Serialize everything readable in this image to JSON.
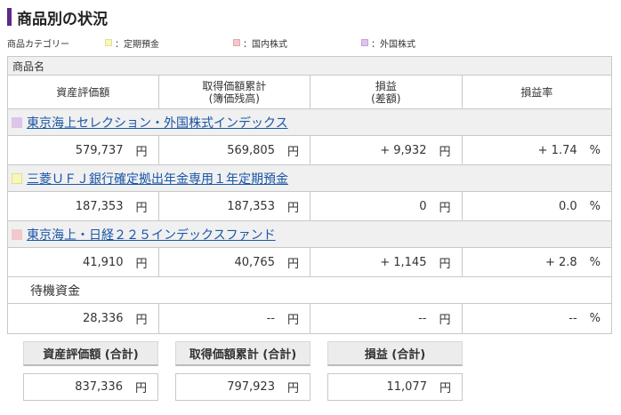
{
  "title": "商品別の状況",
  "legend": {
    "label": "商品カテゴリー",
    "items": [
      {
        "label": "：定期預金",
        "color": "#f7f7b8"
      },
      {
        "label": "：国内株式",
        "color": "#f2c8cc"
      },
      {
        "label": "：外国株式",
        "color": "#dcc4ea"
      }
    ]
  },
  "table": {
    "name_header": "商品名",
    "headers": {
      "col1": "資産評価額",
      "col2_line1": "取得価額累計",
      "col2_line2": "(簿価残高)",
      "col3_line1": "損益",
      "col3_line2": "(差額)",
      "col4": "損益率"
    },
    "unit_yen": "円",
    "unit_pct": "%",
    "products": [
      {
        "name": "東京海上セレクション・外国株式インデックス",
        "color": "#dcc4ea",
        "value": "579,737",
        "cost": "569,805",
        "pl": "+ 9,932",
        "rate": "+ 1.74"
      },
      {
        "name": "三菱ＵＦＪ銀行確定拠出年金専用１年定期預金",
        "color": "#f7f7b8",
        "value": "187,353",
        "cost": "187,353",
        "pl": "0",
        "rate": "0.0"
      },
      {
        "name": "東京海上・日経２２５インデックスファンド",
        "color": "#f2c8cc",
        "value": "41,910",
        "cost": "40,765",
        "pl": "+ 1,145",
        "rate": "+ 2.8"
      }
    ],
    "waiting": {
      "name": "待機資金",
      "value": "28,336",
      "cost": "--",
      "pl": "--",
      "rate": "--"
    }
  },
  "totals": {
    "value_label": "資産評価額 (合計)",
    "value": "837,336",
    "cost_label": "取得価額累計 (合計)",
    "cost": "797,923",
    "pl_label": "損益 (合計)",
    "pl": "11,077",
    "unit": "円"
  }
}
